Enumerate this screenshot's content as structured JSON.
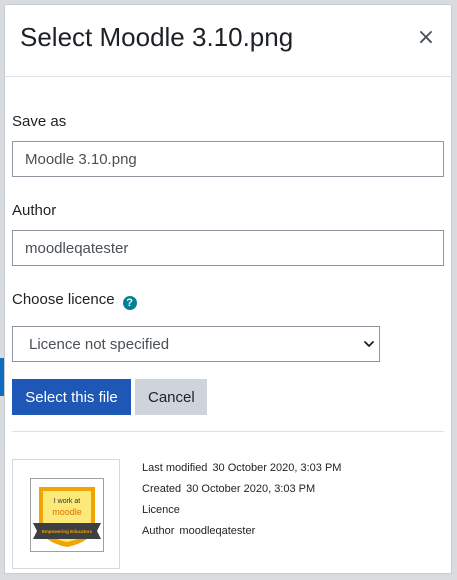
{
  "dialog": {
    "title": "Select Moodle 3.10.png",
    "close_symbol": "×"
  },
  "form": {
    "save_as": {
      "label": "Save as",
      "value": "Moodle 3.10.png"
    },
    "author": {
      "label": "Author",
      "value": "moodleqatester"
    },
    "licence": {
      "label": "Choose licence",
      "help_symbol": "?",
      "selected": "Licence not specified"
    }
  },
  "buttons": {
    "select_label": "Select this file",
    "cancel_label": "Cancel"
  },
  "thumbnail": {
    "line1": "I work at",
    "line2": "moodle",
    "banner": "Empowering Educators"
  },
  "file_details": {
    "last_modified": {
      "key": "Last modified",
      "value": "30 October 2020, 3:03 PM"
    },
    "created": {
      "key": "Created",
      "value": "30 October 2020, 3:03 PM"
    },
    "licence": {
      "key": "Licence",
      "value": ""
    },
    "author": {
      "key": "Author",
      "value": "moodleqatester"
    }
  },
  "colors": {
    "primary_button": "#1f57b7",
    "secondary_button": "#ced4da",
    "help_icon": "#008196",
    "badge_orange": "#f0a500",
    "badge_banner": "#3d3f42"
  }
}
